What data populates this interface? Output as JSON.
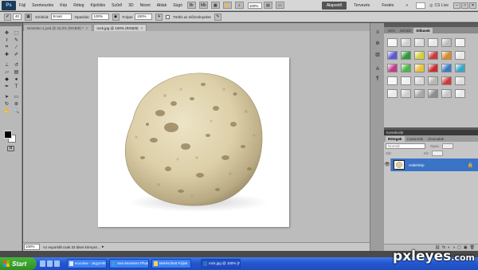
{
  "app": {
    "logo": "Ps",
    "menu": [
      "Fájl",
      "Szerkesztés",
      "Kép",
      "Réteg",
      "Kijelölés",
      "Szűrő",
      "3D",
      "Nézet",
      "Ablak",
      "Súgó"
    ],
    "zoom": "100%",
    "workspaces": [
      "Alapvető",
      "Tervezés",
      "Festés",
      "»"
    ],
    "active_workspace": "Alapvető",
    "cslive": "CS Live",
    "window_buttons": [
      "–",
      "□",
      "✕"
    ]
  },
  "options": {
    "brush_size": "40",
    "mode_label": "Színkód:",
    "mode_value": "Ecset",
    "opacity_label": "Opacitás:",
    "opacity_value": "100%",
    "flow_label": "Folyat:",
    "flow_value": "100%",
    "checkbox_label": "Törlés az előzményekre"
  },
  "tools": [
    {
      "name": "move-tool-icon",
      "glyph": "✥"
    },
    {
      "name": "marquee-tool-icon",
      "glyph": "⬚"
    },
    {
      "name": "lasso-tool-icon",
      "glyph": "ℓ"
    },
    {
      "name": "quick-select-tool-icon",
      "glyph": "✎"
    },
    {
      "name": "crop-tool-icon",
      "glyph": "⌗"
    },
    {
      "name": "eyedropper-tool-icon",
      "glyph": "⁄"
    },
    {
      "name": "healing-tool-icon",
      "glyph": "✚"
    },
    {
      "name": "brush-tool-icon",
      "glyph": "✐"
    },
    {
      "name": "stamp-tool-icon",
      "glyph": "⊥"
    },
    {
      "name": "history-brush-tool-icon",
      "glyph": "↺"
    },
    {
      "name": "eraser-tool-icon",
      "glyph": "▱"
    },
    {
      "name": "gradient-tool-icon",
      "glyph": "▤"
    },
    {
      "name": "blur-tool-icon",
      "glyph": "◆"
    },
    {
      "name": "dodge-tool-icon",
      "glyph": "●"
    },
    {
      "name": "pen-tool-icon",
      "glyph": "✒"
    },
    {
      "name": "type-tool-icon",
      "glyph": "T"
    },
    {
      "name": "path-select-tool-icon",
      "glyph": "➤"
    },
    {
      "name": "shape-tool-icon",
      "glyph": "▭"
    },
    {
      "name": "3d-rotate-tool-icon",
      "glyph": "↻"
    },
    {
      "name": "3d-orbit-tool-icon",
      "glyph": "⊛"
    },
    {
      "name": "hand-tool-icon",
      "glyph": "✋"
    },
    {
      "name": "zoom-tool-icon",
      "glyph": "🔍"
    }
  ],
  "document": {
    "tabs": [
      {
        "label": "Névtelen-1.psd @ 33,3% (RGB/8) *",
        "close": "×",
        "active": false
      },
      {
        "label": "rock.jpg @ 100% (RGB/8)",
        "close": "×",
        "active": true
      }
    ],
    "status_zoom": "100%",
    "status_text": "Az exportált csak 32 bites környez...",
    "status_arrow": "▸"
  },
  "panels": {
    "styles_tabs": [
      "Szín",
      "Színtár",
      "Stílusok"
    ],
    "styles_active": "Stílusok",
    "style_swatches": [
      "#f4f4f4",
      "#cfcfcf",
      "#dcdcdc",
      "#e6e6e6",
      "#bdbdbd",
      "#f0f0f0",
      "#5a5ad6",
      "#2f9a3a",
      "#d1d13a",
      "#c93a3a",
      "#d98b2b",
      "#e8e8e8",
      "#c43a8c",
      "#4fb548",
      "#e6c33a",
      "#c72f2f",
      "#3a7bc9",
      "#3aa7c9",
      "#f6f6f6",
      "#efefef",
      "#d8d8d8",
      "#b6b6b6",
      "#cf3b3b",
      "#dedede",
      "#e9e9e9",
      "#cdcdcd",
      "#a8a8a8",
      "#8d8d8d",
      "#c6c6c6",
      "#eaeaea"
    ],
    "strip_icons": [
      "≡",
      "⚙",
      "▥",
      "A",
      "¶"
    ],
    "layers_header": "Korrekciók",
    "layers_tabs": [
      "Rétegek",
      "Csatornák",
      "Útvonalak"
    ],
    "layers_active": "Rétegek",
    "blend_mode": "Normál",
    "opacity_label": "Opac.:",
    "lock_label": "Zár:",
    "fill_label": "Kit.:",
    "layer": {
      "name": "Háttérkép",
      "lock": "🔒",
      "eye": "👁"
    },
    "bottom_icons": [
      "⛓",
      "fx",
      "◐",
      "◑",
      "▢",
      "▣",
      "🗑"
    ]
  },
  "taskbar": {
    "start": "Start",
    "tasks": [
      {
        "label": "ecoolow - Jegyzettömb",
        "color": "#dfe8f6",
        "active": false
      },
      {
        "label": "Sea Monsters Photos...",
        "color": "#3a9be0",
        "active": false
      },
      {
        "label": "Bekészített Fájlok",
        "color": "#f4d35e",
        "active": false
      },
      {
        "label": "rock.jpg @ 100% (R...",
        "color": "#2f6fbf",
        "active": true
      }
    ]
  },
  "watermark": {
    "main": "pxleyes",
    "suffix": ".com"
  }
}
